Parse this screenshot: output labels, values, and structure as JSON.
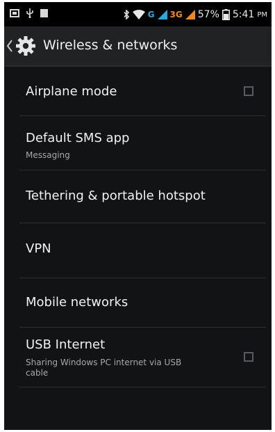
{
  "status_bar": {
    "network_g": "G",
    "network_3g": "3G",
    "battery": "57%",
    "time": "5:41",
    "ampm": "PM"
  },
  "action_bar": {
    "title": "Wireless & networks"
  },
  "items": [
    {
      "title": "Airplane mode",
      "subtitle": "",
      "checkbox": true,
      "checked": false
    },
    {
      "title": "Default SMS app",
      "subtitle": "Messaging",
      "checkbox": false
    },
    {
      "title": "Tethering & portable hotspot",
      "subtitle": "",
      "checkbox": false
    },
    {
      "title": "VPN",
      "subtitle": "",
      "checkbox": false
    },
    {
      "title": "Mobile networks",
      "subtitle": "",
      "checkbox": false
    },
    {
      "title": "USB Internet",
      "subtitle": "Sharing Windows PC internet via USB cable",
      "checkbox": true,
      "checked": false
    }
  ]
}
